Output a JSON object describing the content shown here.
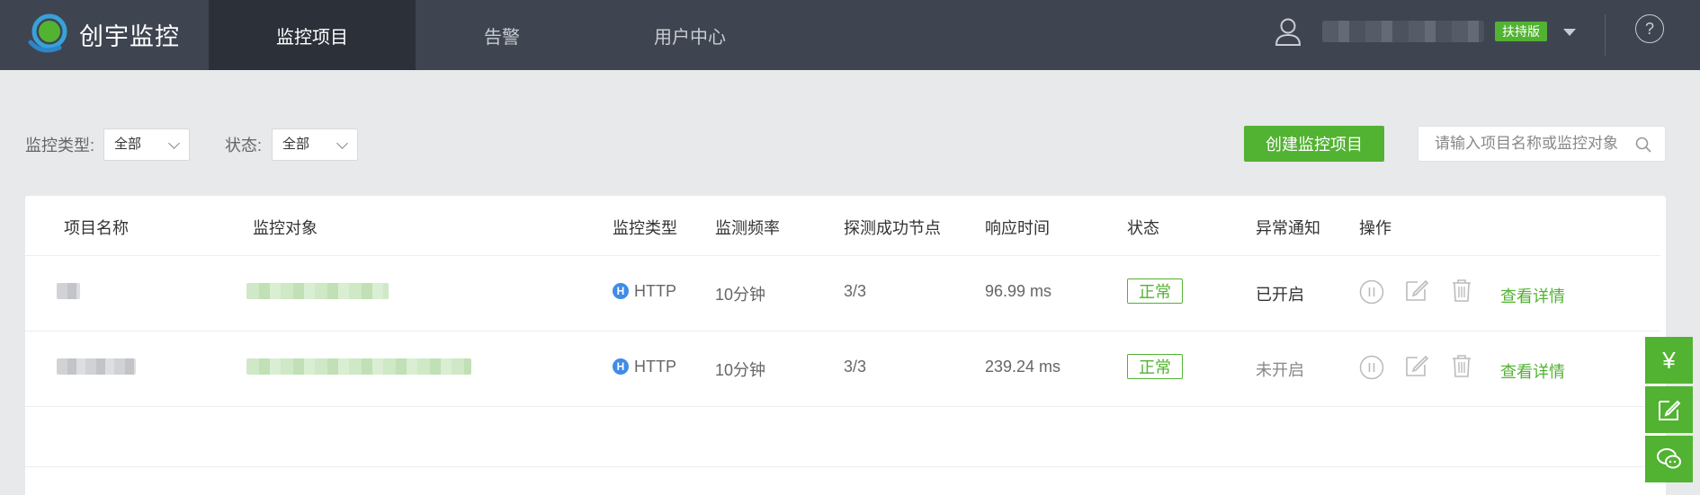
{
  "app": {
    "name": "创宇监控"
  },
  "nav": [
    {
      "label": "监控项目",
      "active": true
    },
    {
      "label": "告警",
      "active": false
    },
    {
      "label": "用户中心",
      "active": false
    }
  ],
  "user": {
    "plan_badge": "扶持版",
    "help_label": "?"
  },
  "filters": {
    "type_label": "监控类型:",
    "type_value": "全部",
    "status_label": "状态:",
    "status_value": "全部"
  },
  "toolbar": {
    "create_label": "创建监控项目",
    "search_placeholder": "请输入项目名称或监控对象"
  },
  "table": {
    "headers": [
      "项目名称",
      "监控对象",
      "监控类型",
      "监测频率",
      "探测成功节点",
      "响应时间",
      "状态",
      "异常通知",
      "操作"
    ],
    "rows": [
      {
        "type_icon": "H",
        "type": "HTTP",
        "frequency": "10分钟",
        "nodes": "3/3",
        "response": "96.99 ms",
        "status": "正常",
        "notify": "已开启",
        "detail": "查看详情"
      },
      {
        "type_icon": "H",
        "type": "HTTP",
        "frequency": "10分钟",
        "nodes": "3/3",
        "response": "239.24 ms",
        "status": "正常",
        "notify": "未开启",
        "detail": "查看详情"
      }
    ]
  },
  "float_tools": [
    {
      "icon": "yuan-icon",
      "glyph": "¥"
    },
    {
      "icon": "edit-icon"
    },
    {
      "icon": "chat-icon"
    }
  ],
  "colors": {
    "accent": "#52b232",
    "topbar": "#3f4550",
    "topbar_active": "#2b3039",
    "info": "#3f8ce8"
  }
}
